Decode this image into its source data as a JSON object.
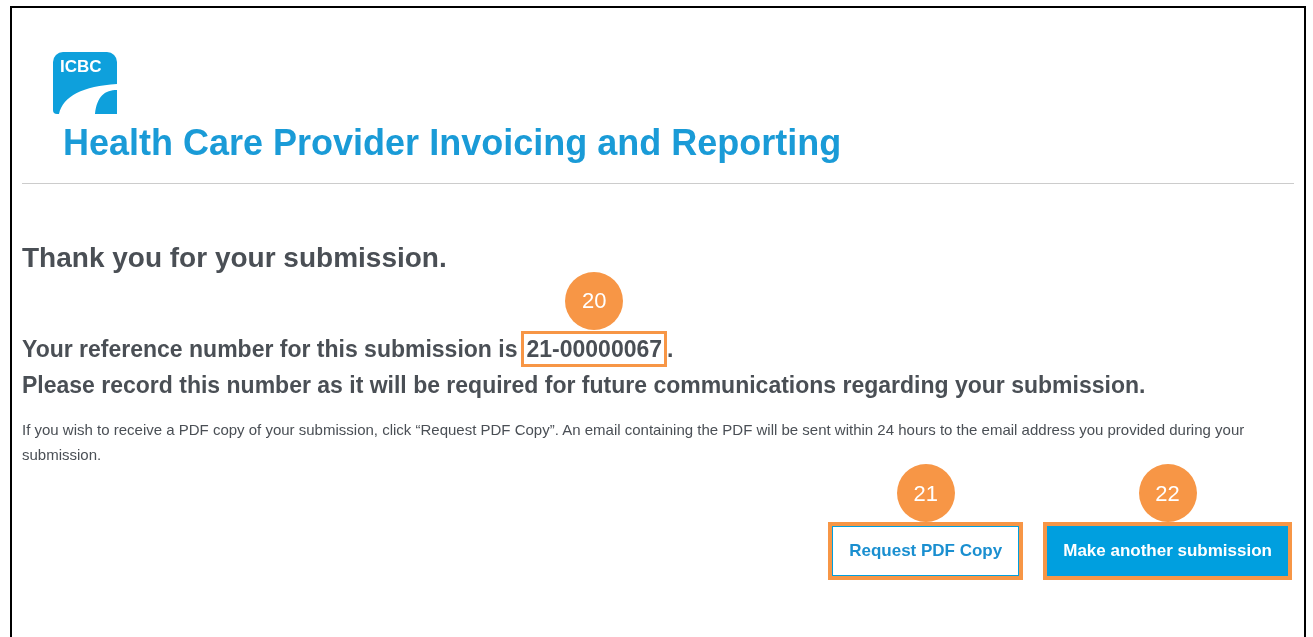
{
  "logo": {
    "text": "ICBC"
  },
  "title": "Health Care Provider Invoicing and Reporting",
  "heading": "Thank you for your submission.",
  "reference": {
    "prefix": "Your reference number for this submission is",
    "number": "21-00000067",
    "suffix": ".",
    "callout": "20"
  },
  "note": "Please record this number as it will be required for future communications regarding your submission.",
  "info": "If you wish to receive a PDF copy of your submission, click “Request PDF Copy”. An email containing the PDF will be sent within 24 hours to the email address you provided during your submission.",
  "buttons": [
    {
      "label": "Request PDF Copy",
      "kind": "secondary",
      "callout": "21"
    },
    {
      "label": "Make another submission",
      "kind": "primary",
      "callout": "22"
    }
  ]
}
